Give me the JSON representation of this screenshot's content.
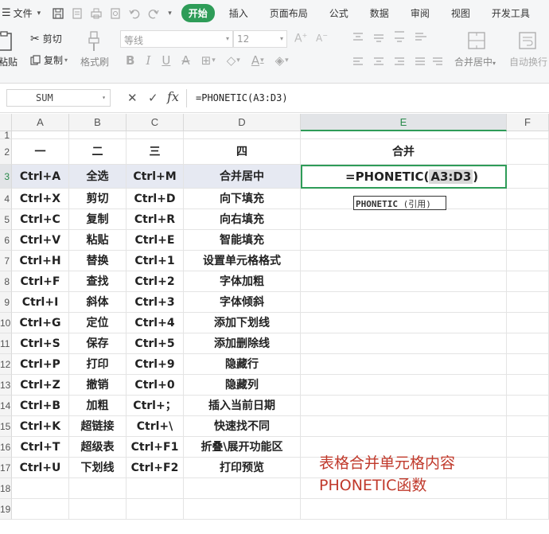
{
  "menubar": {
    "file_label": "文件",
    "tabs": [
      "开始",
      "插入",
      "页面布局",
      "公式",
      "数据",
      "审阅",
      "视图",
      "开发工具"
    ]
  },
  "ribbon": {
    "paste_label": "粘贴",
    "cut_label": "剪切",
    "copy_label": "复制",
    "format_painter_label": "格式刷",
    "font_name": "等线",
    "font_size": "12",
    "merge_label": "合并居中",
    "wrap_label": "自动换行"
  },
  "formula_bar": {
    "name_box": "SUM",
    "formula": "=PHONETIC(A3:D3)"
  },
  "sheet": {
    "columns": [
      "A",
      "B",
      "C",
      "D",
      "E",
      "F"
    ],
    "row_numbers": [
      "1",
      "2",
      "3",
      "4",
      "5",
      "6",
      "7",
      "8",
      "9",
      "10",
      "11",
      "12",
      "13",
      "14",
      "15",
      "16",
      "17",
      "18",
      "19"
    ],
    "headers": [
      "一",
      "二",
      "三",
      "四"
    ],
    "merge_header": "合并",
    "rows": [
      [
        "Ctrl+A",
        "全选",
        "Ctrl+M",
        "合并居中"
      ],
      [
        "Ctrl+X",
        "剪切",
        "Ctrl+D",
        "向下填充"
      ],
      [
        "Ctrl+C",
        "复制",
        "Ctrl+R",
        "向右填充"
      ],
      [
        "Ctrl+V",
        "粘贴",
        "Ctrl+E",
        "智能填充"
      ],
      [
        "Ctrl+H",
        "替换",
        "Ctrl+1",
        "设置单元格格式"
      ],
      [
        "Ctrl+F",
        "查找",
        "Ctrl+2",
        "字体加粗"
      ],
      [
        "Ctrl+I",
        "斜体",
        "Ctrl+3",
        "字体倾斜"
      ],
      [
        "Ctrl+G",
        "定位",
        "Ctrl+4",
        "添加下划线"
      ],
      [
        "Ctrl+S",
        "保存",
        "Ctrl+5",
        "添加删除线"
      ],
      [
        "Ctrl+P",
        "打印",
        "Ctrl+9",
        "隐藏行"
      ],
      [
        "Ctrl+Z",
        "撤销",
        "Ctrl+0",
        "隐藏列"
      ],
      [
        "Ctrl+B",
        "加粗",
        "Ctrl+；",
        "插入当前日期"
      ],
      [
        "Ctrl+K",
        "超链接",
        "Ctrl+\\",
        "快速找不同"
      ],
      [
        "Ctrl+T",
        "超级表",
        "Ctrl+F1",
        "折叠\\展开功能区"
      ],
      [
        "Ctrl+U",
        "下划线",
        "Ctrl+F2",
        "打印预览"
      ]
    ],
    "active_cell": {
      "prefix": "=PHONETIC(",
      "ref": "A3:D3",
      "suffix": ")"
    },
    "tooltip": {
      "func": "PHONETIC",
      "arg": " (引用)"
    }
  },
  "annotation": {
    "line1": "表格合并单元格内容",
    "line2": "PHONETIC函数"
  },
  "colors": {
    "accent": "#2e9c58",
    "annotation": "#c0392b",
    "selected_row": "#e6e9f2"
  }
}
